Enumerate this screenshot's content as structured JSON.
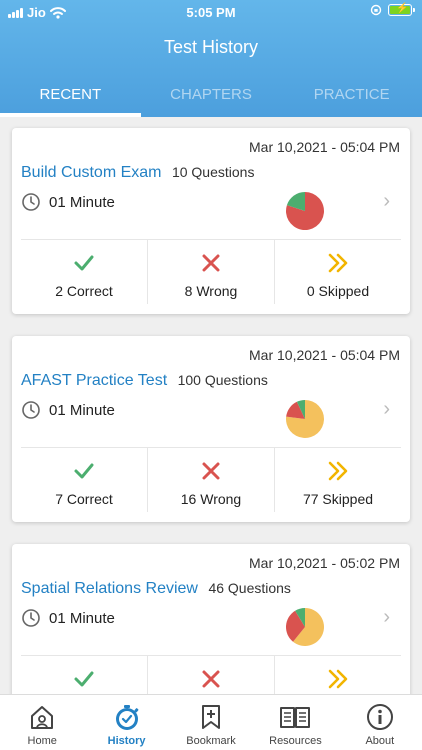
{
  "status": {
    "carrier": "Jio",
    "time": "5:05 PM"
  },
  "header": {
    "title": "Test History"
  },
  "tabs": [
    {
      "label": "RECENT",
      "active": true
    },
    {
      "label": "CHAPTERS",
      "active": false
    },
    {
      "label": "PRACTICE",
      "active": false
    }
  ],
  "tests": [
    {
      "date": "Mar 10,2021 - 05:04 PM",
      "name": "Build Custom Exam",
      "questions": "10 Questions",
      "time": "01 Minute",
      "correct": "2 Correct",
      "wrong": "8 Wrong",
      "skipped": "0 Skipped",
      "breakdown": {
        "correct": 2,
        "wrong": 8,
        "skipped": 0
      }
    },
    {
      "date": "Mar 10,2021 - 05:04 PM",
      "name": "AFAST Practice Test",
      "questions": "100 Questions",
      "time": "01 Minute",
      "correct": "7 Correct",
      "wrong": "16 Wrong",
      "skipped": "77 Skipped",
      "breakdown": {
        "correct": 7,
        "wrong": 16,
        "skipped": 77
      }
    },
    {
      "date": "Mar 10,2021 - 05:02 PM",
      "name": "Spatial Relations Review",
      "questions": "46 Questions",
      "time": "01 Minute",
      "correct": "",
      "wrong": "",
      "skipped": "",
      "breakdown": {
        "correct": 4,
        "wrong": 14,
        "skipped": 28
      }
    }
  ],
  "colors": {
    "correct": "#4cae6f",
    "wrong": "#d9534f",
    "skipped": "#f4c15d",
    "accent": "#2381c4"
  },
  "nav": [
    {
      "label": "Home",
      "icon": "home-icon",
      "active": false
    },
    {
      "label": "History",
      "icon": "stopwatch-icon",
      "active": true
    },
    {
      "label": "Bookmark",
      "icon": "bookmark-icon",
      "active": false
    },
    {
      "label": "Resources",
      "icon": "book-icon",
      "active": false
    },
    {
      "label": "About",
      "icon": "info-icon",
      "active": false
    }
  ]
}
